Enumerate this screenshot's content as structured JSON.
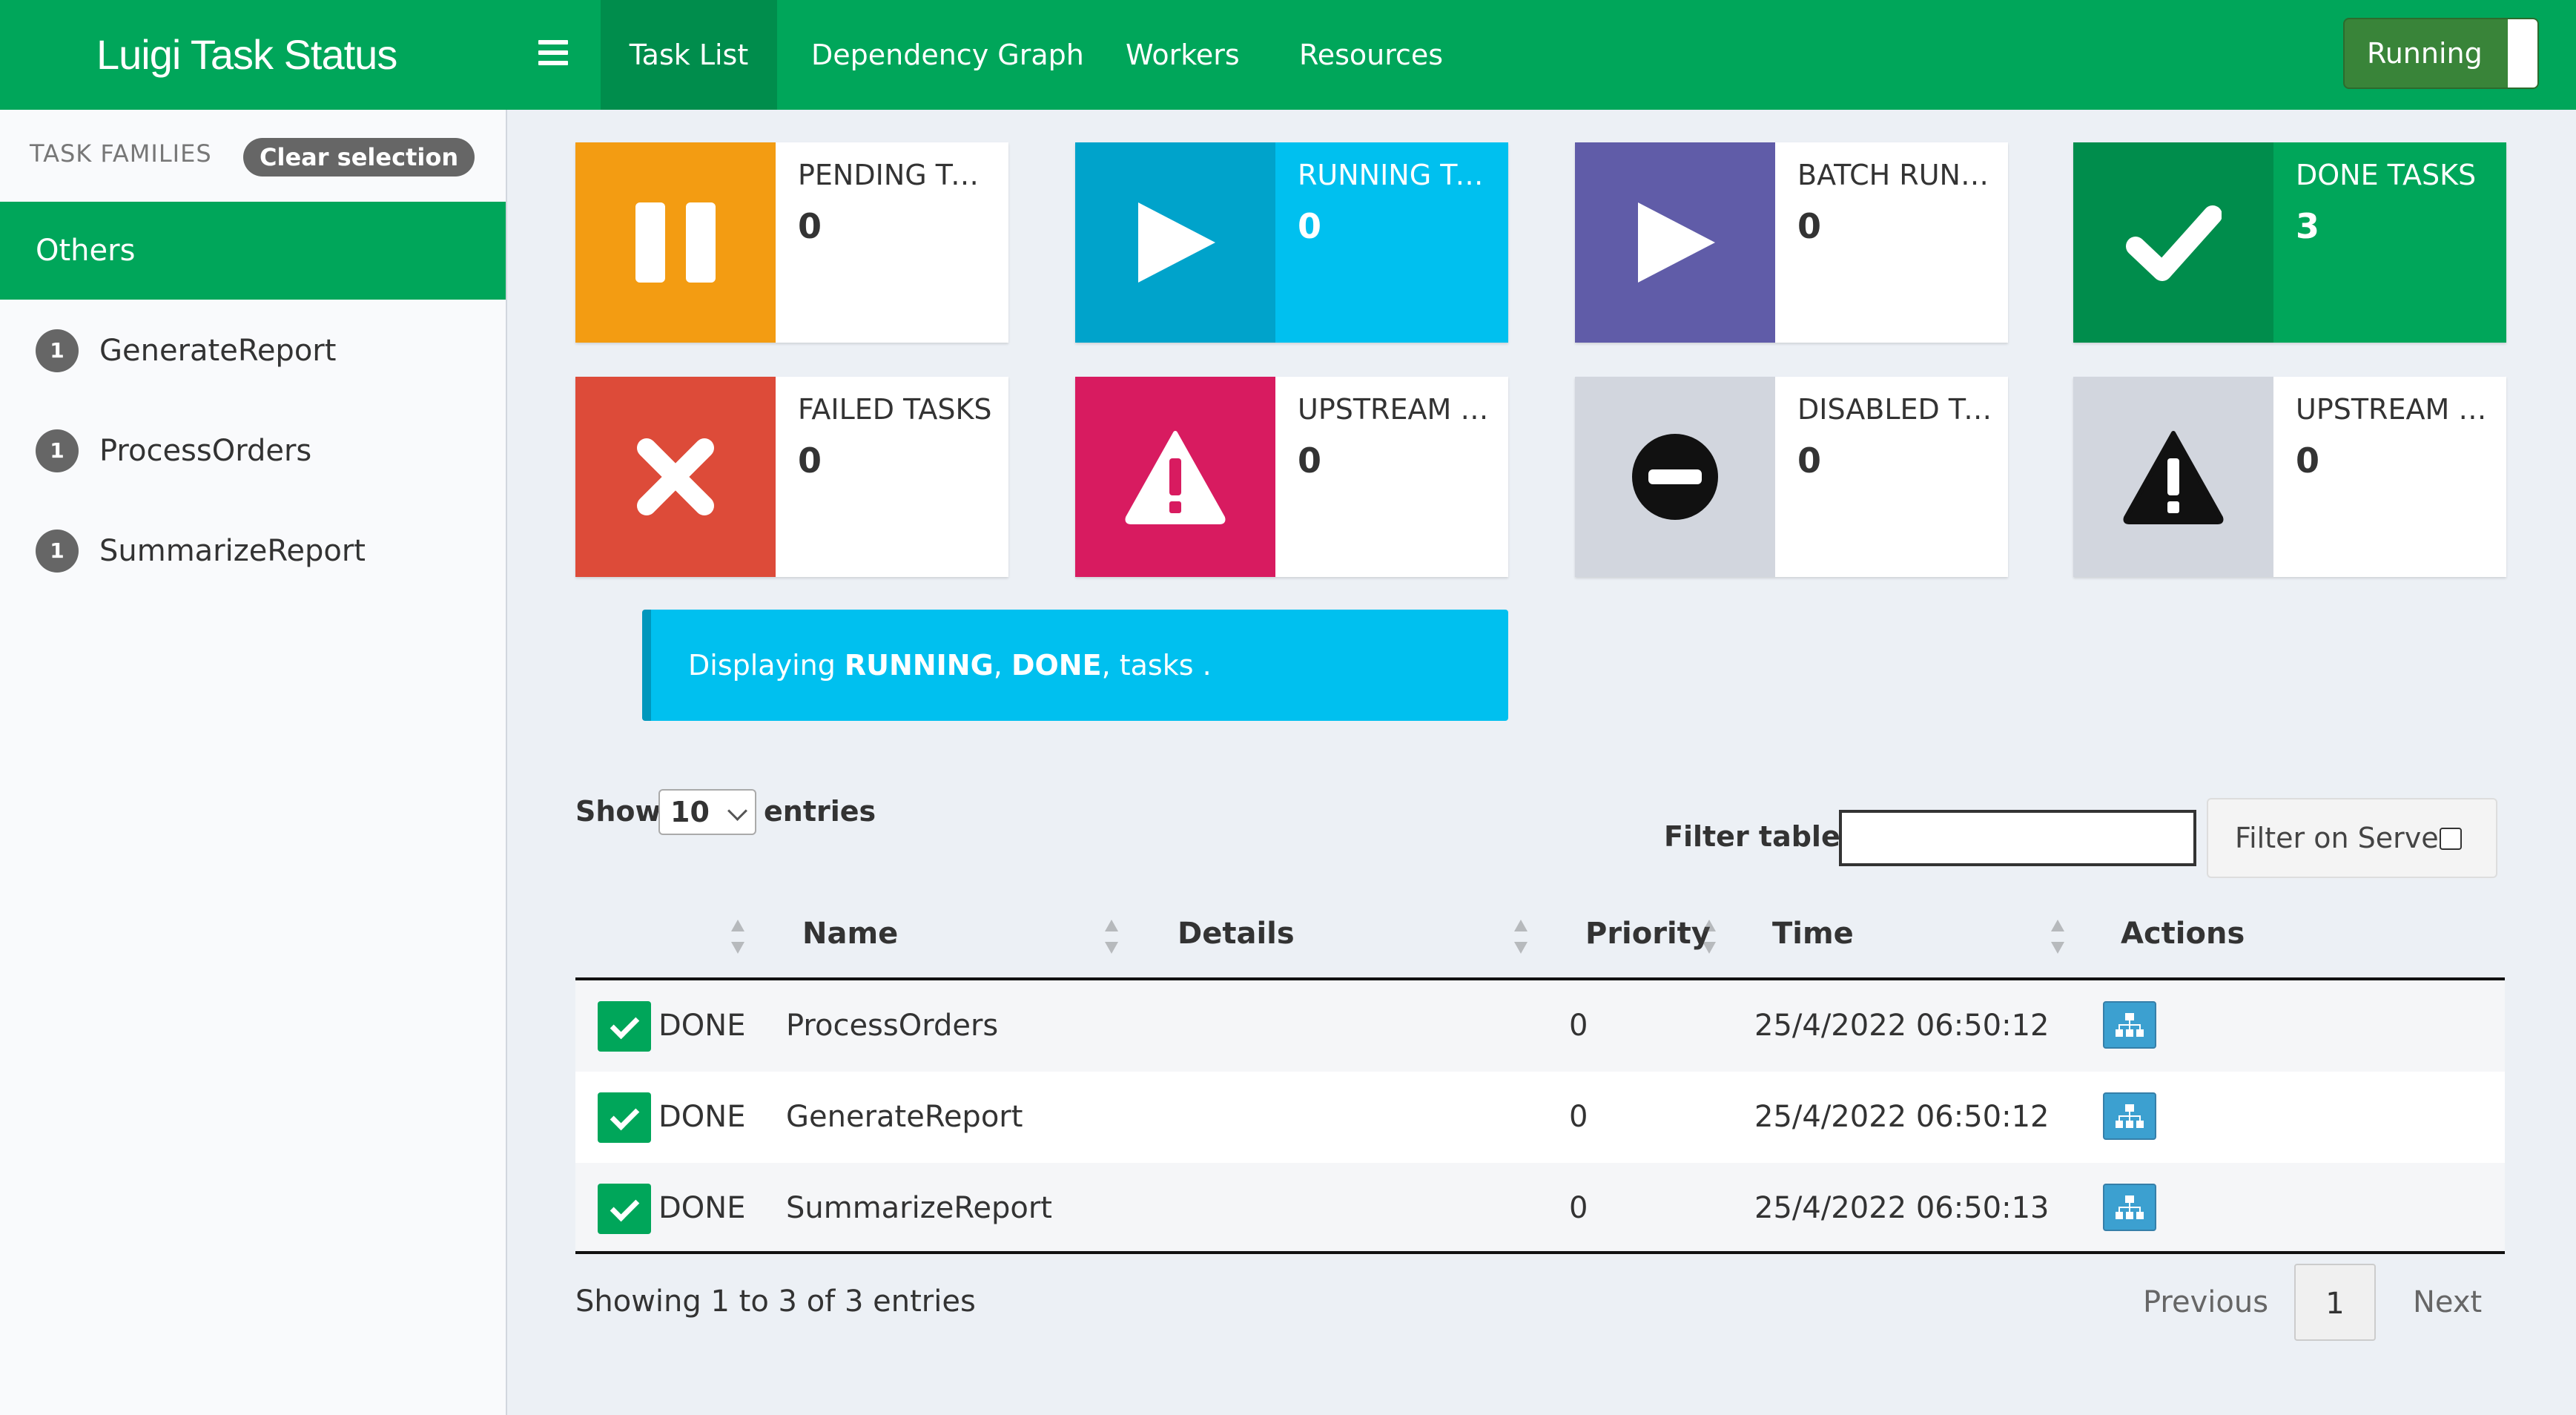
{
  "app": {
    "title": "Luigi Task Status"
  },
  "nav": {
    "items": [
      {
        "label": "Task List",
        "active": true
      },
      {
        "label": "Dependency Graph",
        "active": false
      },
      {
        "label": "Workers",
        "active": false
      },
      {
        "label": "Resources",
        "active": false
      }
    ],
    "status_toggle": "Running"
  },
  "sidebar": {
    "header": "TASK FAMILIES",
    "clear_label": "Clear selection",
    "active_group": "Others",
    "items": [
      {
        "count": "1",
        "name": "GenerateReport"
      },
      {
        "count": "1",
        "name": "ProcessOrders"
      },
      {
        "count": "1",
        "name": "SummarizeReport"
      }
    ]
  },
  "info_boxes": [
    {
      "label": "PENDING TASKS",
      "value": "0",
      "icon": "pause-icon",
      "color": "#f39c12"
    },
    {
      "label": "RUNNING TASKS",
      "value": "0",
      "icon": "play-icon",
      "color": "#00c0ef"
    },
    {
      "label": "BATCH RUNNING TASKS",
      "value": "0",
      "icon": "play-icon",
      "color": "#605ca8"
    },
    {
      "label": "DONE TASKS",
      "value": "3",
      "icon": "check-icon",
      "color": "#00a65a"
    },
    {
      "label": "FAILED TASKS",
      "value": "0",
      "icon": "times-icon",
      "color": "#dd4b39"
    },
    {
      "label": "UPSTREAM FAILURE",
      "value": "0",
      "icon": "warning-icon",
      "color": "#d81b60"
    },
    {
      "label": "DISABLED TASKS",
      "value": "0",
      "icon": "minus-circle-icon",
      "color": "#d2d6de"
    },
    {
      "label": "UPSTREAM DISABLED",
      "value": "0",
      "icon": "warning-icon",
      "color": "#d2d6de"
    }
  ],
  "callout": {
    "prefix": "Displaying ",
    "status1": "RUNNING",
    "sep": ", ",
    "status2": "DONE",
    "suffix": ", tasks ."
  },
  "table_controls": {
    "show_label": "Show",
    "page_size": "10",
    "entries_label": "entries",
    "filter_label": "Filter table:",
    "filter_value": "",
    "filter_server_label": "Filter on Server"
  },
  "table": {
    "columns": [
      "",
      "Name",
      "Details",
      "Priority",
      "Time",
      "Actions"
    ],
    "rows": [
      {
        "status": "DONE",
        "name": "ProcessOrders",
        "details": "",
        "priority": "0",
        "time": "25/4/2022 06:50:12"
      },
      {
        "status": "DONE",
        "name": "GenerateReport",
        "details": "",
        "priority": "0",
        "time": "25/4/2022 06:50:12"
      },
      {
        "status": "DONE",
        "name": "SummarizeReport",
        "details": "",
        "priority": "0",
        "time": "25/4/2022 06:50:13"
      }
    ]
  },
  "pagination": {
    "info": "Showing 1 to 3 of 3 entries",
    "previous": "Previous",
    "current": "1",
    "next": "Next"
  }
}
